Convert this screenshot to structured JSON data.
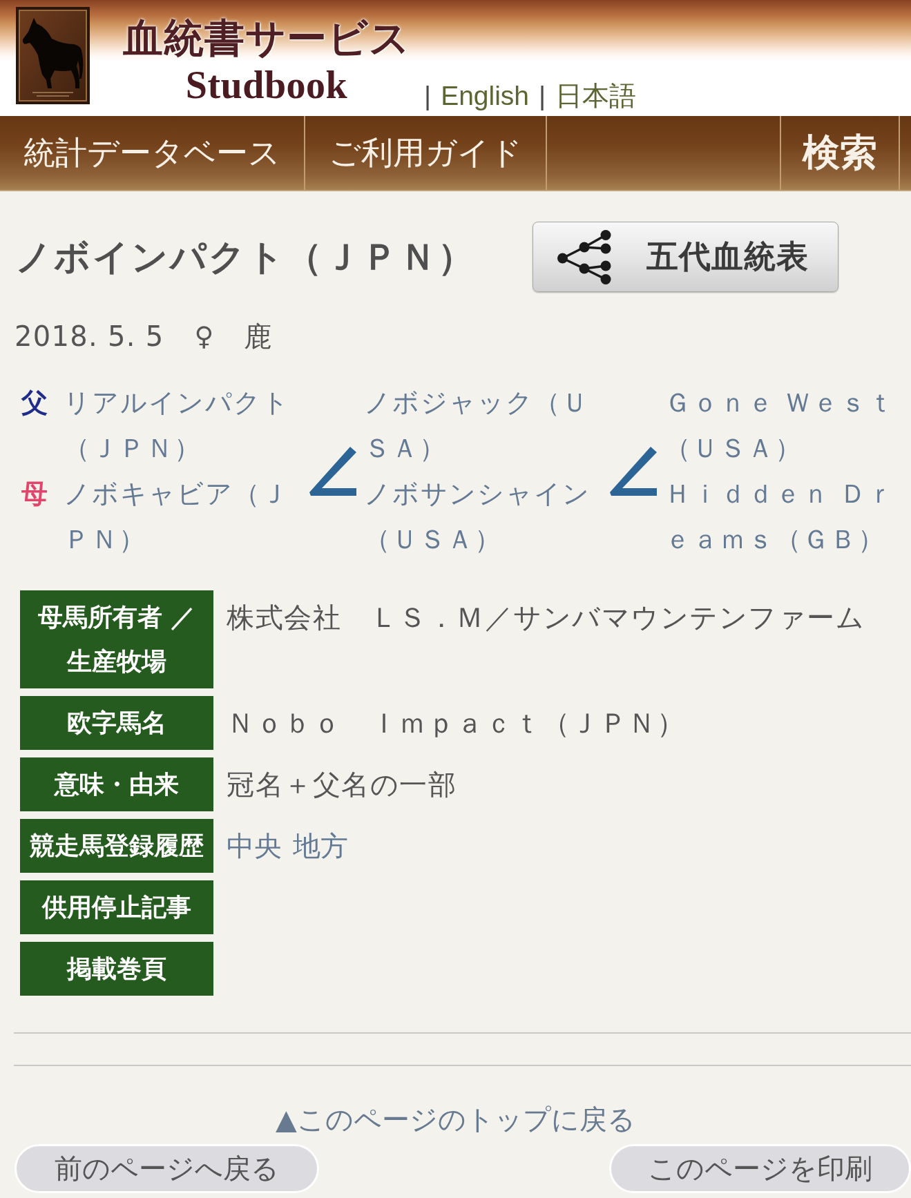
{
  "header": {
    "title": "血統書サービス",
    "subtitle": "Studbook",
    "languages": [
      {
        "separator": "|",
        "label": "English"
      },
      {
        "separator": "|",
        "label": "日本語"
      }
    ]
  },
  "nav": [
    {
      "kind": "link",
      "label": "統計データベース"
    },
    {
      "kind": "link",
      "label": "ご利用ガイド"
    },
    {
      "kind": "search",
      "label": "検索"
    }
  ],
  "horse": {
    "name": "ノボインパクト（ＪＰＮ）",
    "pedigree_button": "五代血統表",
    "birth_date": "2018. 5. 5",
    "sex": "♀",
    "coat_color": "鹿"
  },
  "pedigree": {
    "columns": [
      {
        "entries": [
          {
            "kind": "sire",
            "label": "父",
            "name": "リアルインパクト（ＪＰＮ）"
          },
          {
            "kind": "dam",
            "label": "母",
            "name": "ノボキャビア（ＪＰＮ）"
          }
        ]
      },
      {
        "entries": [
          {
            "name": "ノボジャック（ＵＳＡ）"
          },
          {
            "name": "ノボサンシャイン（ＵＳＡ）"
          }
        ]
      },
      {
        "entries": [
          {
            "name": "Ｇｏｎｅ Ｗｅｓｔ（ＵＳＡ）"
          },
          {
            "name": "Ｈｉｄｄｅｎ Ｄｒｅａｍｓ（ＧＢ）"
          }
        ]
      }
    ]
  },
  "details": [
    {
      "label": "母馬所有者 ／生産牧場",
      "value": "株式会社　ＬＳ．Ｍ／サンバマウンテンファーム"
    },
    {
      "label": "欧字馬名",
      "value": "Ｎｏｂｏ　Ｉｍｐａｃｔ（ＪＰＮ）"
    },
    {
      "label": "意味・由来",
      "value": "冠名＋父名の一部"
    },
    {
      "label": "競走馬登録履歴",
      "links": [
        "中央",
        "地方"
      ]
    },
    {
      "label": "供用停止記事"
    },
    {
      "label": "掲載巻頁"
    }
  ],
  "footer": {
    "top_link": "▲このページのトップに戻る",
    "back_button": "前のページへ戻る",
    "print_button": "このページを印刷"
  }
}
